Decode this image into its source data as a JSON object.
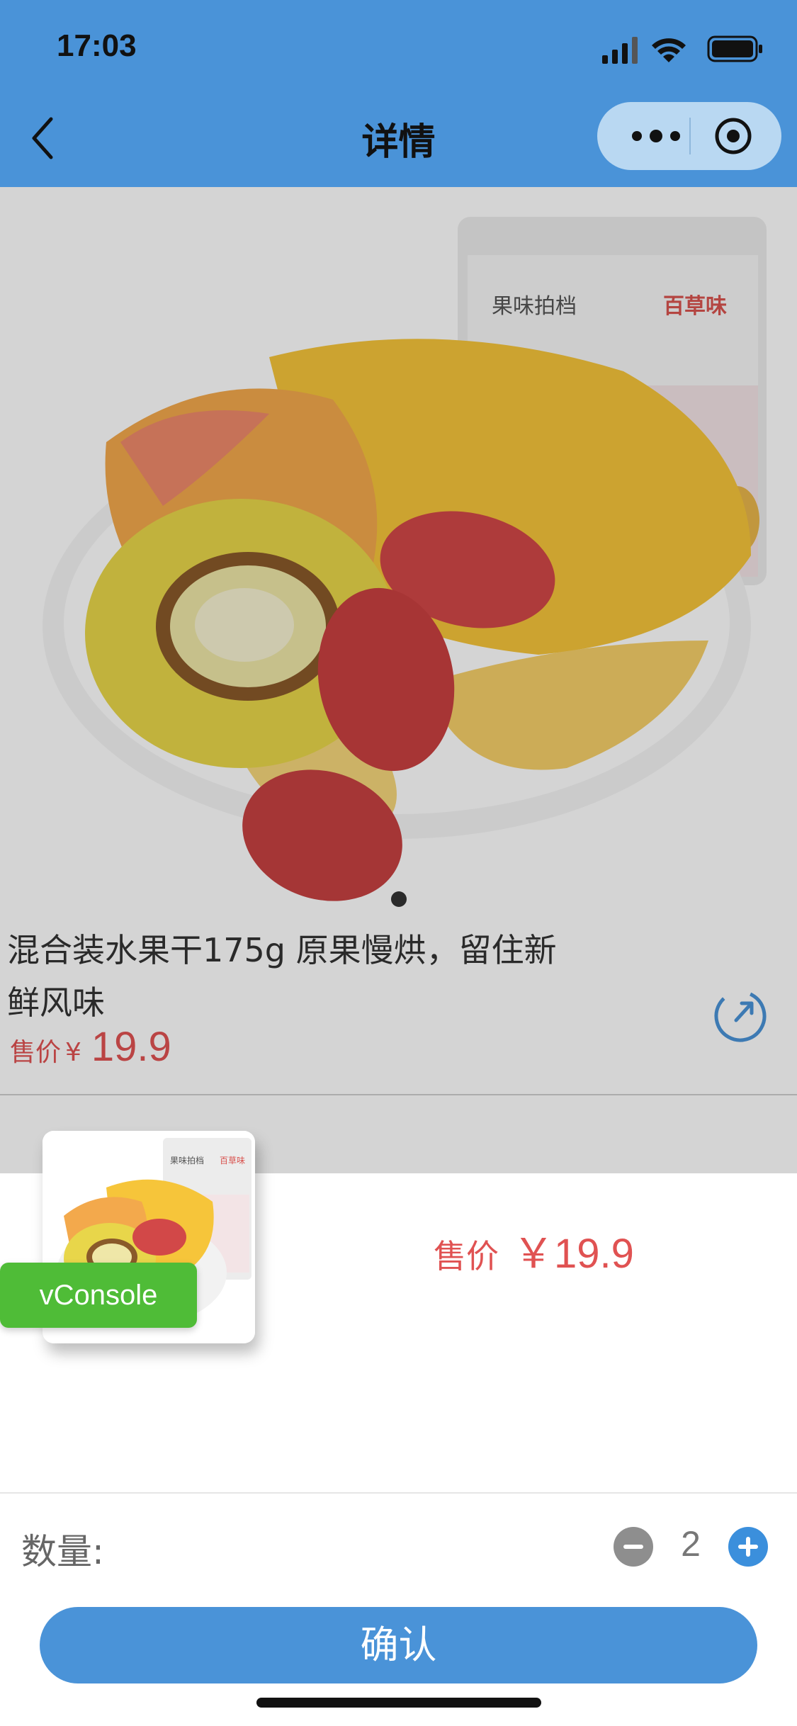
{
  "status_bar": {
    "time": "17:03"
  },
  "nav": {
    "title": "详情"
  },
  "product": {
    "title_line1": "混合装水果干175g      原果慢烘，留住新",
    "title_line2": "鲜风味",
    "price_label": "售价",
    "currency": "¥",
    "price": "19.9",
    "package_brand": "果味拍档",
    "package_logo": "百草味"
  },
  "sheet": {
    "price_label": "售价",
    "price": "￥19.9",
    "quantity_label": "数量:",
    "quantity": "2",
    "confirm_label": "确认"
  },
  "debug": {
    "vconsole_label": "vConsole"
  },
  "colors": {
    "accent": "#4a93d8",
    "price": "#e05252",
    "vconsole": "#4fbc37"
  }
}
